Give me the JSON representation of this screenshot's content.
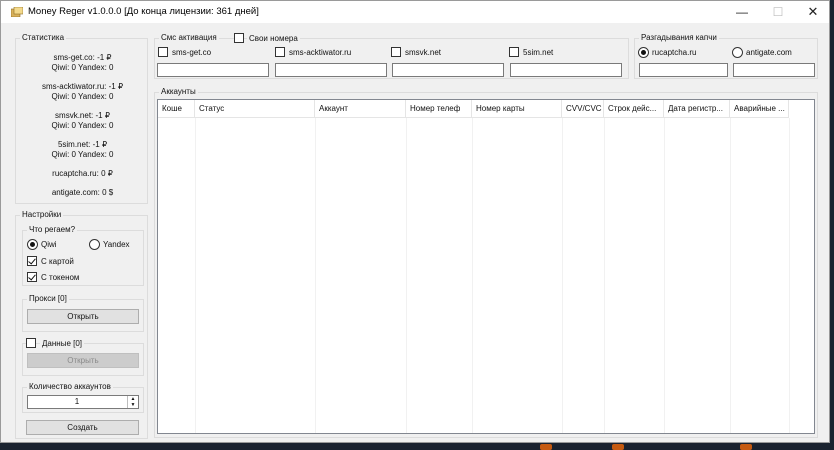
{
  "window": {
    "title": "Money Reger v1.0.0.0 [До конца лицензии: 361 дней]",
    "minimize_symbol": "—",
    "maximize_symbol": "☐",
    "close_symbol": "✕"
  },
  "stats": {
    "label": "Статистика",
    "items": [
      {
        "line1": "sms-get.co: -1 ₽",
        "line2": "Qiwi: 0 Yandex: 0"
      },
      {
        "line1": "sms-acktiwator.ru: -1 ₽",
        "line2": "Qiwi: 0 Yandex: 0"
      },
      {
        "line1": "smsvk.net: -1 ₽",
        "line2": "Qiwi: 0 Yandex: 0"
      },
      {
        "line1": "5sim.net: -1 ₽",
        "line2": "Qiwi: 0 Yandex: 0"
      }
    ],
    "rucaptcha": "rucaptcha.ru: 0 ₽",
    "antigate": "antigate.com: 0 $"
  },
  "settings": {
    "label": "Настройки",
    "what_label": "Что регаем?",
    "qiwi": "Qiwi",
    "yandex": "Yandex",
    "with_card": "С картой",
    "with_token": "С токеном",
    "proxy_label": "Прокси [0]",
    "open_label": "Открыть",
    "data_label": "Данные [0]",
    "open_disabled_label": "Открыть",
    "count_label": "Количество аккаунтов",
    "count_value": "1",
    "create_label": "Создать"
  },
  "sms": {
    "label": "Смс активация",
    "own_numbers": "Свои номера",
    "services": [
      "sms-get.co",
      "sms-acktiwator.ru",
      "smsvk.net",
      "5sim.net"
    ]
  },
  "captcha": {
    "label": "Разгадывания капчи",
    "options": [
      "rucaptcha.ru",
      "antigate.com"
    ]
  },
  "accounts": {
    "label": "Аккаунты",
    "columns": [
      "Коше",
      "Статус",
      "Аккаунт",
      "Номер телеф",
      "Номер карты",
      "CVV/CVC",
      "Строк дейс...",
      "Дата регистр...",
      "Аварийные ..."
    ]
  }
}
